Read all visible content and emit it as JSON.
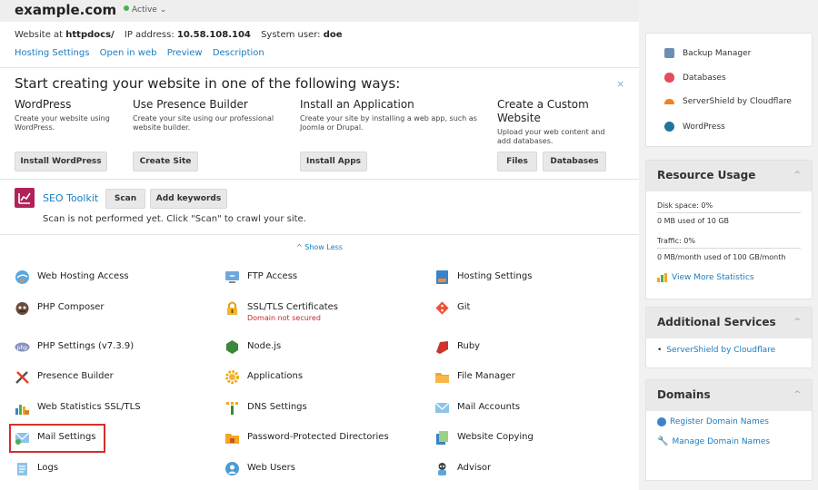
{
  "header": {
    "domain": "example.com",
    "status": "Active"
  },
  "info": {
    "website_label": "Website at",
    "docroot": "httpdocs/",
    "ip_label": "IP address:",
    "ip": "10.58.108.104",
    "user_label": "System user:",
    "user": "doe"
  },
  "quick_links": [
    "Hosting Settings",
    "Open in web",
    "Preview",
    "Description"
  ],
  "start": {
    "title": "Start creating your website in one of the following ways:",
    "close": "×",
    "options": [
      {
        "title": "WordPress",
        "desc": "Create your website using WordPress.",
        "buttons": [
          "Install WordPress"
        ]
      },
      {
        "title": "Use Presence Builder",
        "desc": "Create your site using our professional website builder.",
        "buttons": [
          "Create Site"
        ]
      },
      {
        "title": "Install an Application",
        "desc": "Create your site by installing a web app, such as Joomla or Drupal.",
        "buttons": [
          "Install Apps"
        ]
      },
      {
        "title": "Create a Custom Website",
        "desc": "Upload your web content and add databases.",
        "buttons": [
          "Files",
          "Databases"
        ]
      }
    ]
  },
  "seo": {
    "title": "SEO Toolkit",
    "scan": "Scan",
    "add_keywords": "Add keywords",
    "desc": "Scan is not performed yet. Click \"Scan\" to crawl your site."
  },
  "show_less": "^ Show Less",
  "tools": [
    [
      "Web Hosting Access",
      "FTP Access",
      "Hosting Settings"
    ],
    [
      "PHP Composer",
      "SSL/TLS Certificates",
      "Git"
    ],
    [
      "PHP Settings (v7.3.9)",
      "Node.js",
      "Ruby"
    ],
    [
      "Presence Builder",
      "Applications",
      "File Manager"
    ],
    [
      "Web Statistics SSL/TLS",
      "DNS Settings",
      "Mail Accounts"
    ],
    [
      "Mail Settings",
      "Password-Protected Directories",
      "Website Copying"
    ],
    [
      "Logs",
      "Web Users",
      "Advisor"
    ]
  ],
  "ssl_note": "Domain not secured",
  "sidebar": {
    "links": [
      "Backup Manager",
      "Databases",
      "ServerShield by Cloudflare",
      "WordPress"
    ],
    "resource": {
      "title": "Resource Usage",
      "disk_label": "Disk space: 0%",
      "disk_detail": "0 MB used of 10 GB",
      "disk_percent": 0,
      "traffic_label": "Traffic: 0%",
      "traffic_detail": "0 MB/month used of 100 GB/month",
      "traffic_percent": 0,
      "more": "View More Statistics"
    },
    "additional": {
      "title": "Additional Services",
      "item": "ServerShield by Cloudflare"
    },
    "domains": {
      "title": "Domains",
      "register": "Register Domain Names",
      "manage": "Manage Domain Names"
    }
  },
  "colors": {
    "accent": "#1a7cc1",
    "danger": "#d32f2f",
    "active": "#4caf50",
    "seo": "#b0235a"
  }
}
